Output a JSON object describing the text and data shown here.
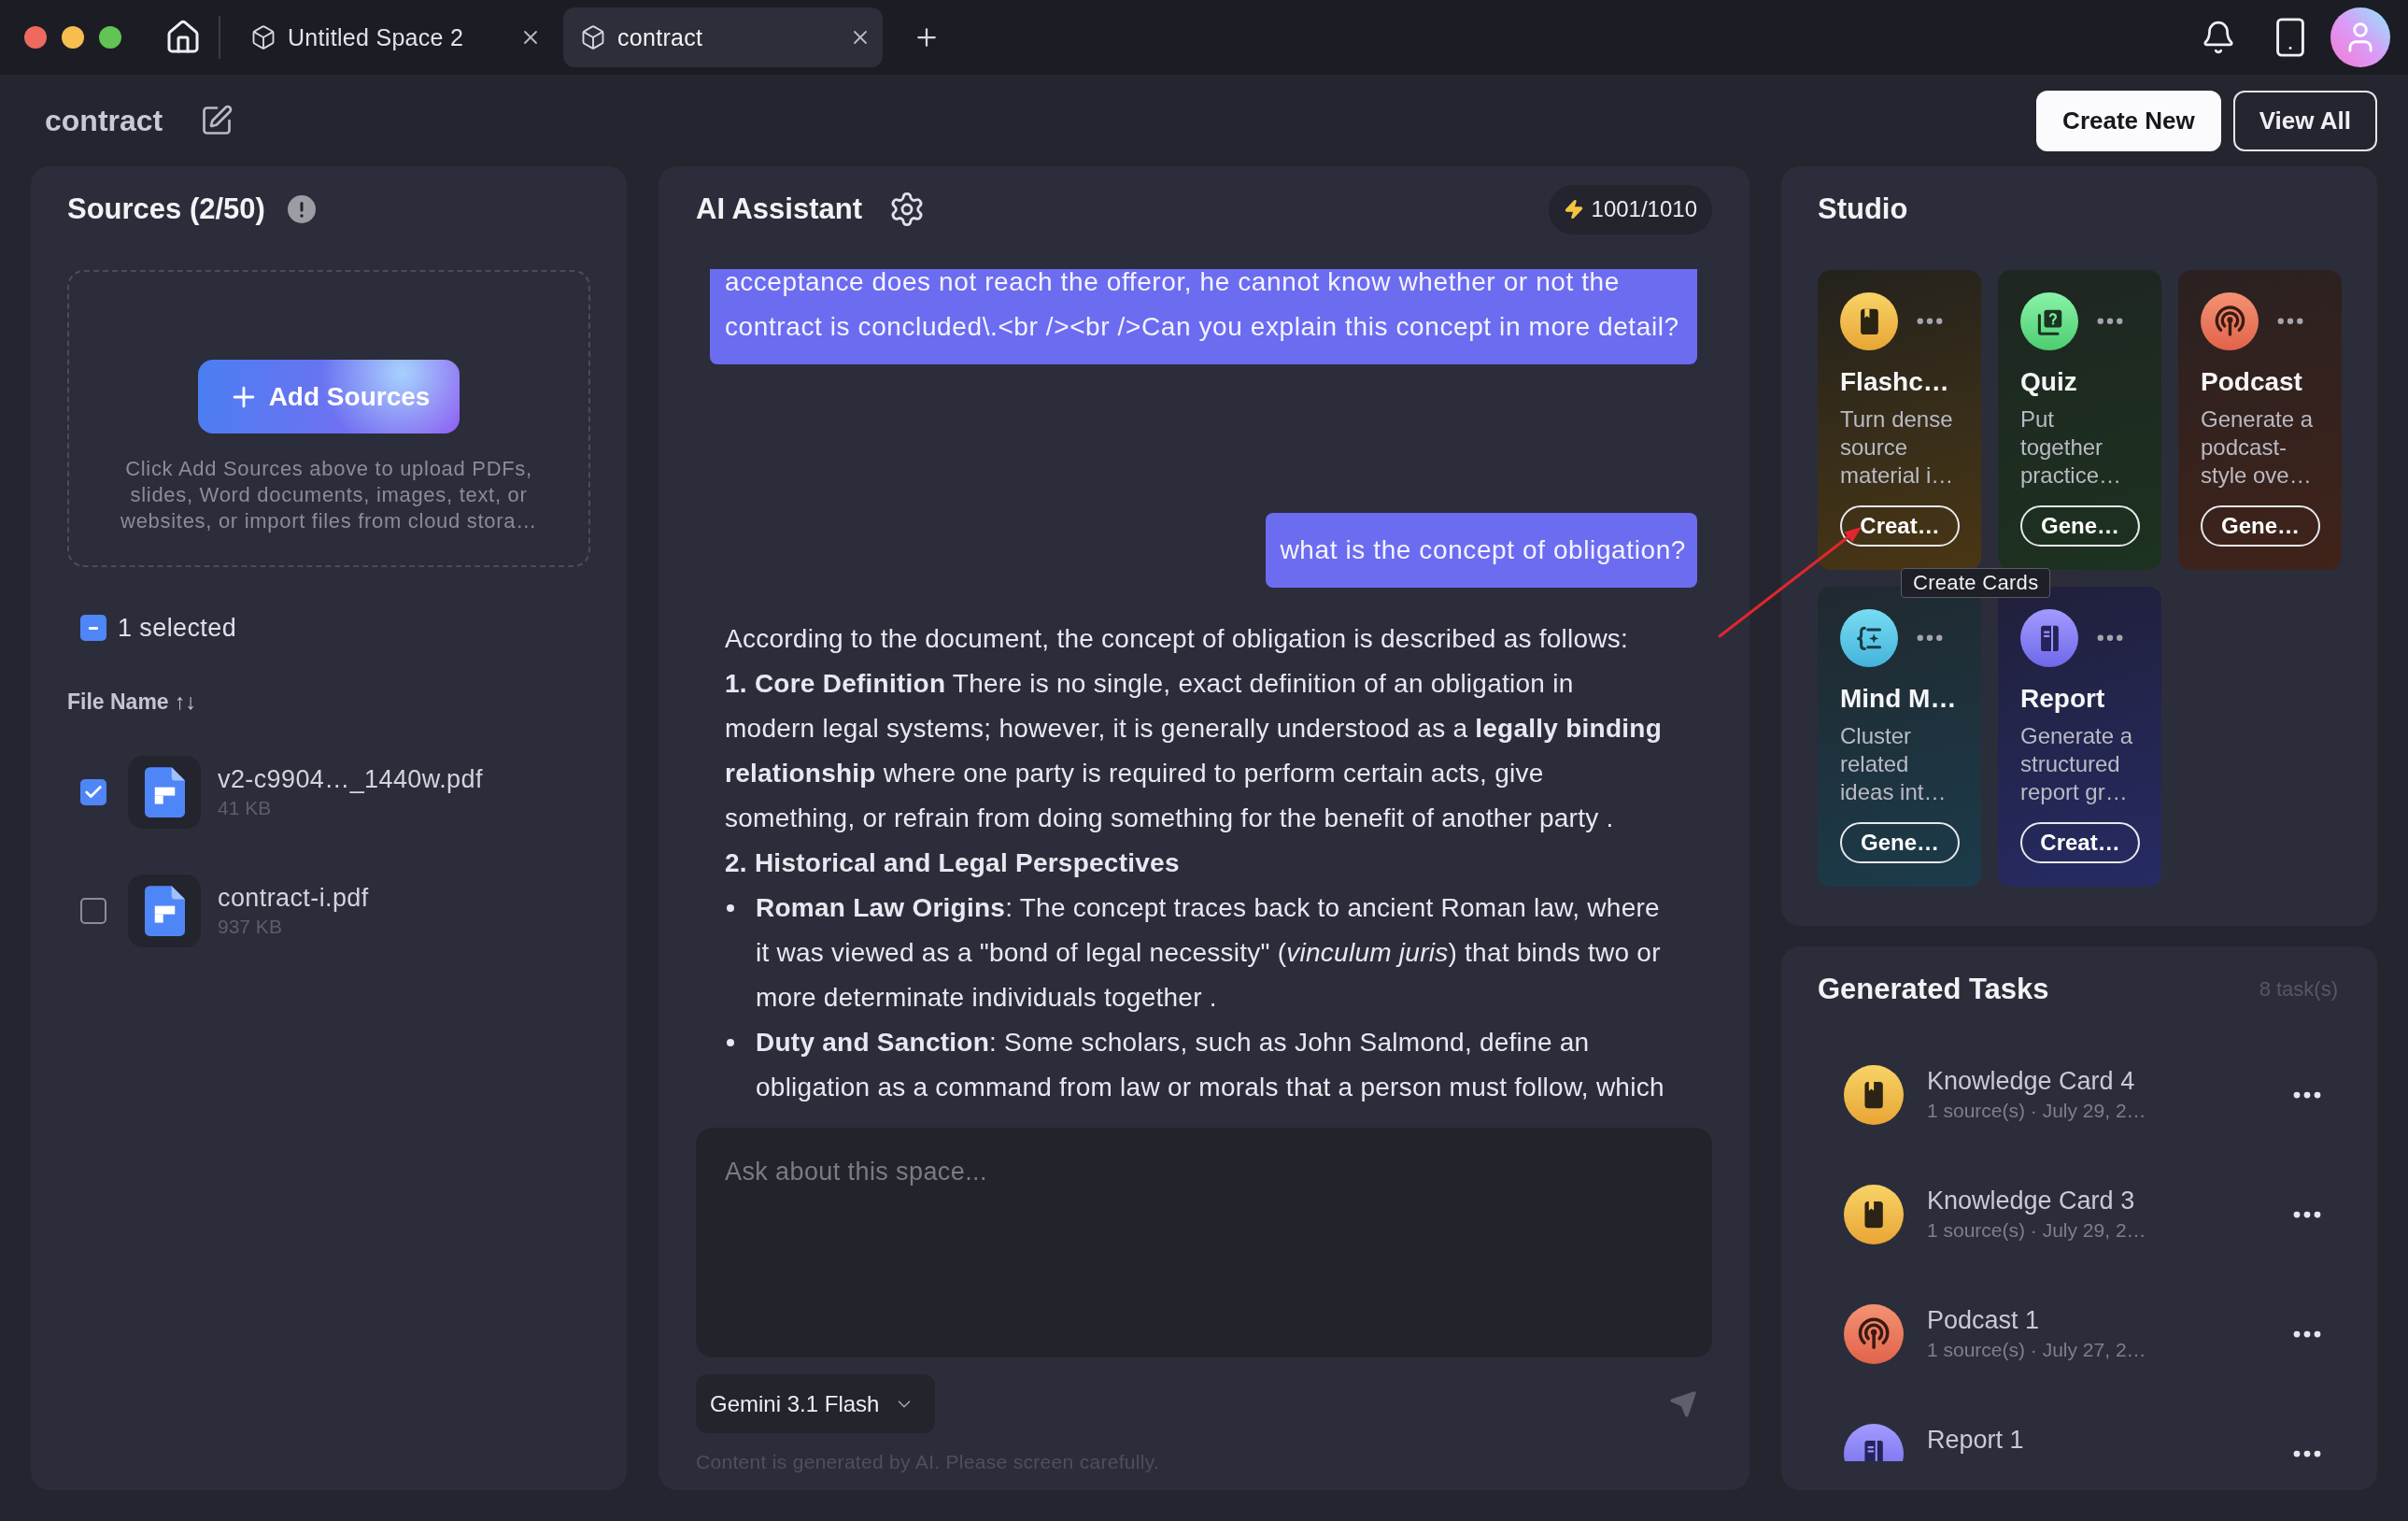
{
  "tabs": [
    {
      "label": "Untitled Space 2",
      "selected": false
    },
    {
      "label": "contract",
      "selected": true
    }
  ],
  "header": {
    "title": "contract",
    "buttons": [
      {
        "label": "Create New",
        "kind": "primary"
      },
      {
        "label": "View All",
        "kind": "outline"
      }
    ]
  },
  "sources": {
    "title": "Sources (2/50)",
    "add_button": "Add Sources",
    "hint": "Click Add Sources above to upload PDFs, slides, Word documents, images, text, or websites, or import files from cloud stora…",
    "selection": {
      "label": "1 selected",
      "indeterminate": true
    },
    "column_header": "File Name ↑↓",
    "files": [
      {
        "name": "v2-c9904…_1440w.pdf",
        "size": "41 KB",
        "checked": true
      },
      {
        "name": "contract-i.pdf",
        "size": "937 KB",
        "checked": false
      }
    ]
  },
  "assistant": {
    "title": "AI Assistant",
    "credits": "1001/1010",
    "messages": [
      {
        "kind": "user",
        "text": "acceptance does not reach the offeror, he cannot know whether or not the contract is concluded\\.<br /><br />Can you explain this concept in more detail?"
      },
      {
        "kind": "user",
        "text": "what is the concept of obligation?"
      },
      {
        "kind": "assistant",
        "blocks": [
          {
            "kind": "paragraph",
            "text": "According to the document, the concept of obligation is described as follows:"
          },
          {
            "kind": "paragraph",
            "text": "**1. Core Definition** There is no single, exact definition of an obligation in modern legal systems; however, it is generally understood as a **legally binding relationship** where one party is required to perform certain acts, give something, or refrain from doing something for the benefit of another party ."
          },
          {
            "kind": "heading",
            "text": "2. Historical and Legal Perspectives"
          },
          {
            "kind": "bullet",
            "text": "**Roman Law Origins**: The concept traces back to ancient Roman law, where it was viewed as a \"bond of legal necessity\" (*vinculum juris*) that binds two or more determinate individuals together ."
          },
          {
            "kind": "bullet",
            "text": "**Duty and Sanction**: Some scholars, such as John Salmond, define an obligation as a command from law or morals that a person must follow, which"
          }
        ]
      }
    ],
    "input": {
      "placeholder": "Ask about this space..."
    },
    "model": "Gemini 3.1 Flash",
    "disclaimer": "Content is generated by AI. Please screen carefully."
  },
  "studio": {
    "title": "Studio",
    "tools": [
      {
        "kind": "flashcards",
        "title": "Flashc…",
        "description": "Turn dense source material i…",
        "action": "Creat…"
      },
      {
        "kind": "quiz",
        "title": "Quiz",
        "description": "Put together practice…",
        "action": "Gene…"
      },
      {
        "kind": "podcast",
        "title": "Podcast",
        "description": "Generate a podcast-style ove…",
        "action": "Gene…"
      },
      {
        "kind": "mindmap",
        "title": "Mind M…",
        "description": "Cluster related ideas int…",
        "action": "Gene…"
      },
      {
        "kind": "report",
        "title": "Report",
        "description": "Generate a structured report gr…",
        "action": "Creat…"
      }
    ],
    "tooltip": "Create Cards"
  },
  "generated_tasks": {
    "title": "Generated Tasks",
    "count": "8 task(s)",
    "tasks": [
      {
        "kind": "flashcards",
        "title": "Knowledge Card 4",
        "meta": "1 source(s) · July 29, 2…"
      },
      {
        "kind": "flashcards",
        "title": "Knowledge Card 3",
        "meta": "1 source(s) · July 29, 2…"
      },
      {
        "kind": "podcast",
        "title": "Podcast 1",
        "meta": "1 source(s) · July 27, 2…"
      },
      {
        "kind": "report",
        "title": "Report 1"
      }
    ]
  },
  "annotation": {
    "kind": "arrow"
  }
}
